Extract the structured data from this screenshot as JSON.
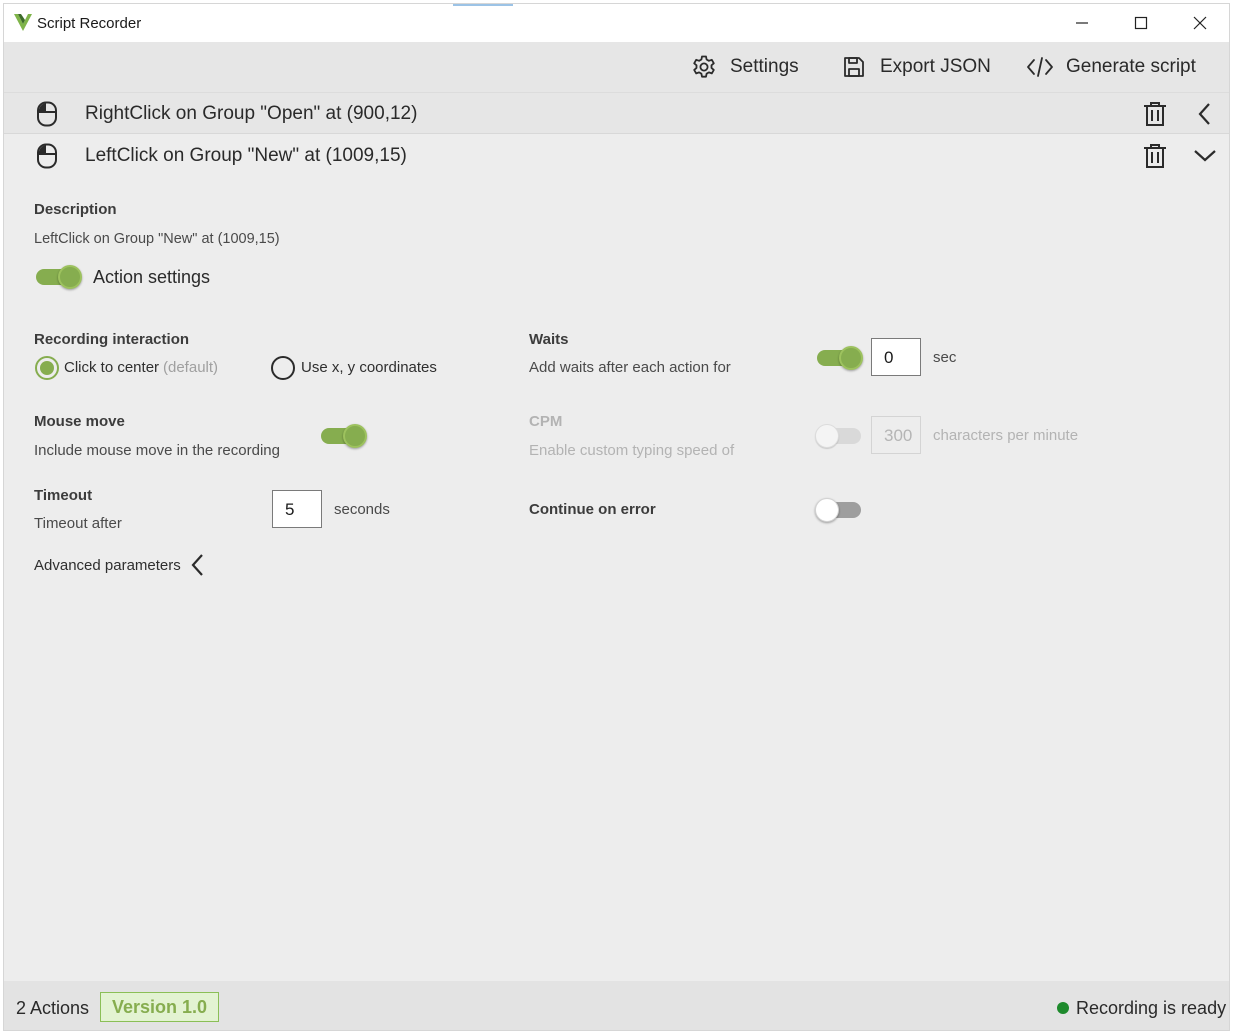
{
  "window": {
    "title": "Script Recorder",
    "controls": {
      "minimize": "minimize-icon",
      "maximize": "maximize-icon",
      "close": "close-icon"
    }
  },
  "toolbar": {
    "settings_label": "Settings",
    "export_label": "Export JSON",
    "generate_label": "Generate script"
  },
  "actions": [
    {
      "label": "RightClick on Group \"Open\" at (900,12)",
      "expanded": false
    },
    {
      "label": "LeftClick on Group \"New\" at (1009,15)",
      "expanded": true
    }
  ],
  "detail": {
    "description_heading": "Description",
    "description_text": "LeftClick on Group \"New\" at (1009,15)",
    "action_settings_label": "Action settings",
    "action_settings_on": true,
    "recording": {
      "heading": "Recording interaction",
      "option_center": "Click to center",
      "option_center_hint": "(default)",
      "option_coords": "Use x, y coordinates",
      "selected": "center"
    },
    "mouse_move": {
      "heading": "Mouse move",
      "text": "Include mouse move in the recording",
      "on": true
    },
    "timeout": {
      "heading": "Timeout",
      "text": "Timeout after",
      "value": "5",
      "unit": "seconds"
    },
    "advanced_label": "Advanced parameters",
    "waits": {
      "heading": "Waits",
      "text": "Add waits after each action for",
      "value": "0",
      "unit": "sec",
      "on": true
    },
    "cpm": {
      "heading": "CPM",
      "text": "Enable custom typing speed of",
      "value": "300",
      "unit": "characters per minute",
      "on": false,
      "disabled": true
    },
    "continue_on_error": {
      "heading": "Continue on error",
      "on": false
    }
  },
  "statusbar": {
    "count": "2 Actions",
    "version": "Version 1.0",
    "status": "Recording is ready",
    "status_color": "#1e8a2c"
  },
  "colors": {
    "accent": "#86ad4f",
    "background": "#ededed"
  }
}
